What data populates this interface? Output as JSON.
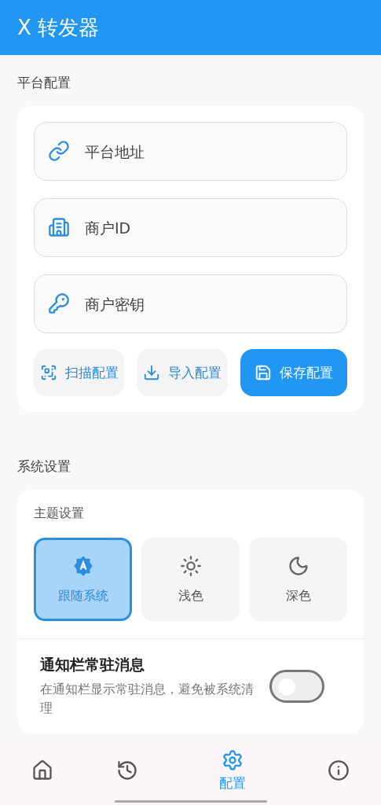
{
  "app_bar": {
    "title": "X 转发器"
  },
  "platform_section": {
    "title": "平台配置",
    "fields": [
      {
        "placeholder": "平台地址"
      },
      {
        "placeholder": "商户ID"
      },
      {
        "placeholder": "商户密钥"
      }
    ],
    "buttons": [
      {
        "label": "扫描配置",
        "kind": "tonal"
      },
      {
        "label": "导入配置",
        "kind": "tonal"
      },
      {
        "label": "保存配置",
        "kind": "primary"
      }
    ]
  },
  "system_section": {
    "title": "系统设置",
    "theme_title": "主题设置",
    "theme_options": [
      {
        "label": "跟随系统",
        "selected": true
      },
      {
        "label": "浅色",
        "selected": false
      },
      {
        "label": "深色",
        "selected": false
      }
    ],
    "notification": {
      "title": "通知栏常驻消息",
      "description": "在通知栏显示常驻消息，避免被系统清理",
      "on": false
    }
  },
  "bottom_nav": [
    {
      "selected": false
    },
    {
      "selected": false
    },
    {
      "label": "配置",
      "selected": true
    },
    {
      "selected": false
    }
  ]
}
